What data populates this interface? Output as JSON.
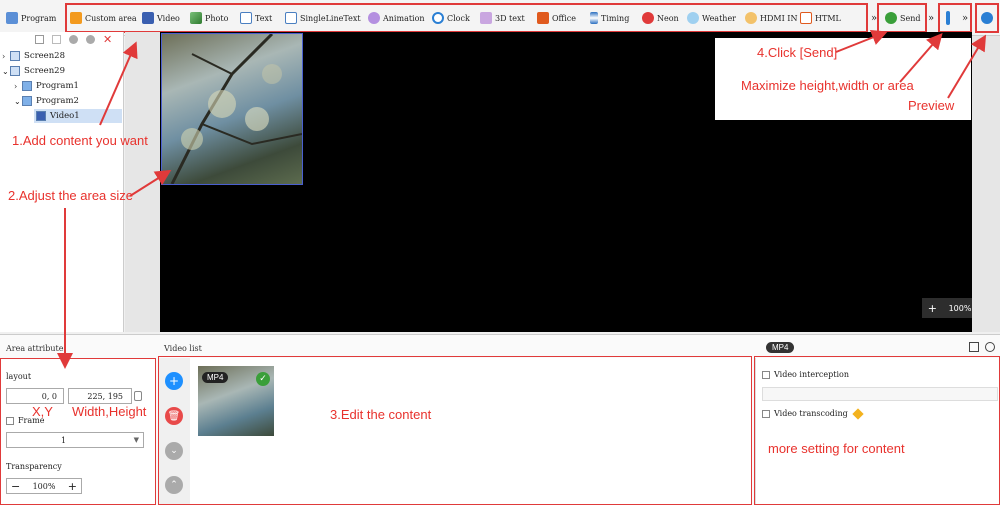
{
  "toolbar": {
    "items": [
      {
        "label": "Program",
        "icon": "program-icon",
        "color": "#5b8fd6"
      },
      {
        "label": "Custom area",
        "icon": "custom-area-icon",
        "color": "#f39a1e"
      },
      {
        "label": "Video",
        "icon": "video-icon",
        "color": "#3a5fb0"
      },
      {
        "label": "Photo",
        "icon": "photo-icon",
        "color": "#3b8f3b"
      },
      {
        "label": "Text",
        "icon": "text-icon",
        "color": "#4a7fc1"
      },
      {
        "label": "SingleLineText",
        "icon": "single-line-text-icon",
        "color": "#4a7fc1"
      },
      {
        "label": "Animation",
        "icon": "animation-icon",
        "color": "#7b4fc1"
      },
      {
        "label": "Clock",
        "icon": "clock-icon",
        "color": "#2a7fd4"
      },
      {
        "label": "3D text",
        "icon": "3d-text-icon",
        "color": "#9b59b6"
      },
      {
        "label": "Office",
        "icon": "office-icon",
        "color": "#e05a1e"
      },
      {
        "label": "Timing",
        "icon": "timing-icon",
        "color": "#2a6fc1"
      },
      {
        "label": "Neon",
        "icon": "neon-icon",
        "color": "#e03a3a"
      },
      {
        "label": "Weather",
        "icon": "weather-icon",
        "color": "#2a9fd4"
      },
      {
        "label": "HDMI IN",
        "icon": "hdmi-in-icon",
        "color": "#f39a1e"
      },
      {
        "label": "HTML",
        "icon": "html-icon",
        "color": "#e05a1e"
      }
    ],
    "more": "»",
    "send": "Send",
    "more2": "»"
  },
  "tree": {
    "nodes": [
      "Screen28",
      "Screen29",
      "Program1",
      "Program2",
      "Video1"
    ]
  },
  "canvas": {
    "zoom": "100%",
    "zoom_in": "+",
    "zoom_out": "−"
  },
  "area_attribute": {
    "title": "Area attribute",
    "layout_label": "layout",
    "xy": "0, 0",
    "wh": "225, 195",
    "frame_label": "Frame",
    "frame_value": "1",
    "transparency_label": "Transparency",
    "transparency_value": "100%",
    "minus": "−",
    "plus": "+"
  },
  "video_list": {
    "title": "Video list",
    "badge": "MP4"
  },
  "right_panel": {
    "badge": "MP4",
    "interception": "Video interception",
    "transcoding": "Video transcoding"
  },
  "annotations": {
    "a1": "1.Add content you want",
    "a2": "2.Adjust the area size",
    "a3": "3.Edit the content",
    "a4": "4.Click [Send]",
    "a5": "Maximize height,width or area",
    "a6": "Preview",
    "a7": "X,Y",
    "a8": "Width,Height",
    "a9": "more setting for content"
  },
  "colors": {
    "accent": "#e03a3a",
    "send_green": "#3a9f3a",
    "add_blue": "#1e90ff",
    "delete_red": "#e84a4a"
  }
}
